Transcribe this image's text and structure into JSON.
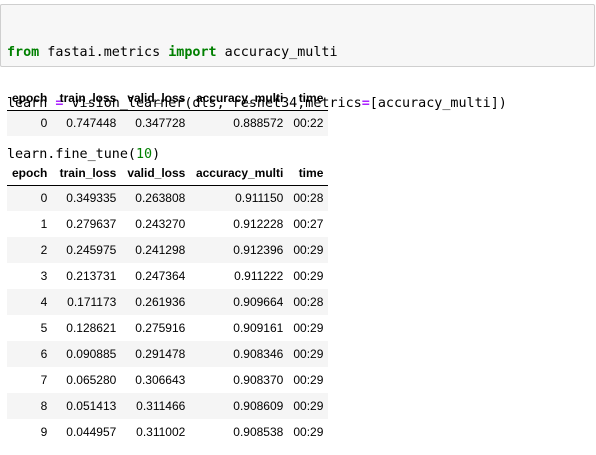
{
  "code": {
    "line1": {
      "kw_from": "from",
      "module": " fastai.metrics ",
      "kw_import": "import",
      "name": " accuracy_multi"
    },
    "line2": {
      "lhs": "learn ",
      "eq": "=",
      "call": " vision_learner(dls, resnet34,metrics",
      "eq2": "=",
      "rest": "[accuracy_multi])"
    },
    "line3": {
      "prefix": "learn.fine_tune(",
      "num": "10",
      "suffix": ")"
    }
  },
  "tables": {
    "headers": [
      "epoch",
      "train_loss",
      "valid_loss",
      "accuracy_multi",
      "time"
    ],
    "frozen": [
      [
        "0",
        "0.747448",
        "0.347728",
        "0.888572",
        "00:22"
      ]
    ],
    "finetune": [
      [
        "0",
        "0.349335",
        "0.263808",
        "0.911150",
        "00:28"
      ],
      [
        "1",
        "0.279637",
        "0.243270",
        "0.912228",
        "00:27"
      ],
      [
        "2",
        "0.245975",
        "0.241298",
        "0.912396",
        "00:29"
      ],
      [
        "3",
        "0.213731",
        "0.247364",
        "0.911222",
        "00:29"
      ],
      [
        "4",
        "0.171173",
        "0.261936",
        "0.909664",
        "00:28"
      ],
      [
        "5",
        "0.128621",
        "0.275916",
        "0.909161",
        "00:29"
      ],
      [
        "6",
        "0.090885",
        "0.291478",
        "0.908346",
        "00:29"
      ],
      [
        "7",
        "0.065280",
        "0.306643",
        "0.908370",
        "00:29"
      ],
      [
        "8",
        "0.051413",
        "0.311466",
        "0.908609",
        "00:29"
      ],
      [
        "9",
        "0.044957",
        "0.311002",
        "0.908538",
        "00:29"
      ]
    ]
  },
  "colors": {
    "keyword": "#008000",
    "operator": "#aa22ff",
    "number": "#008000",
    "cell_background": "#f7f7f7",
    "cell_border": "#cfcfcf",
    "row_stripe": "#f5f5f5"
  }
}
